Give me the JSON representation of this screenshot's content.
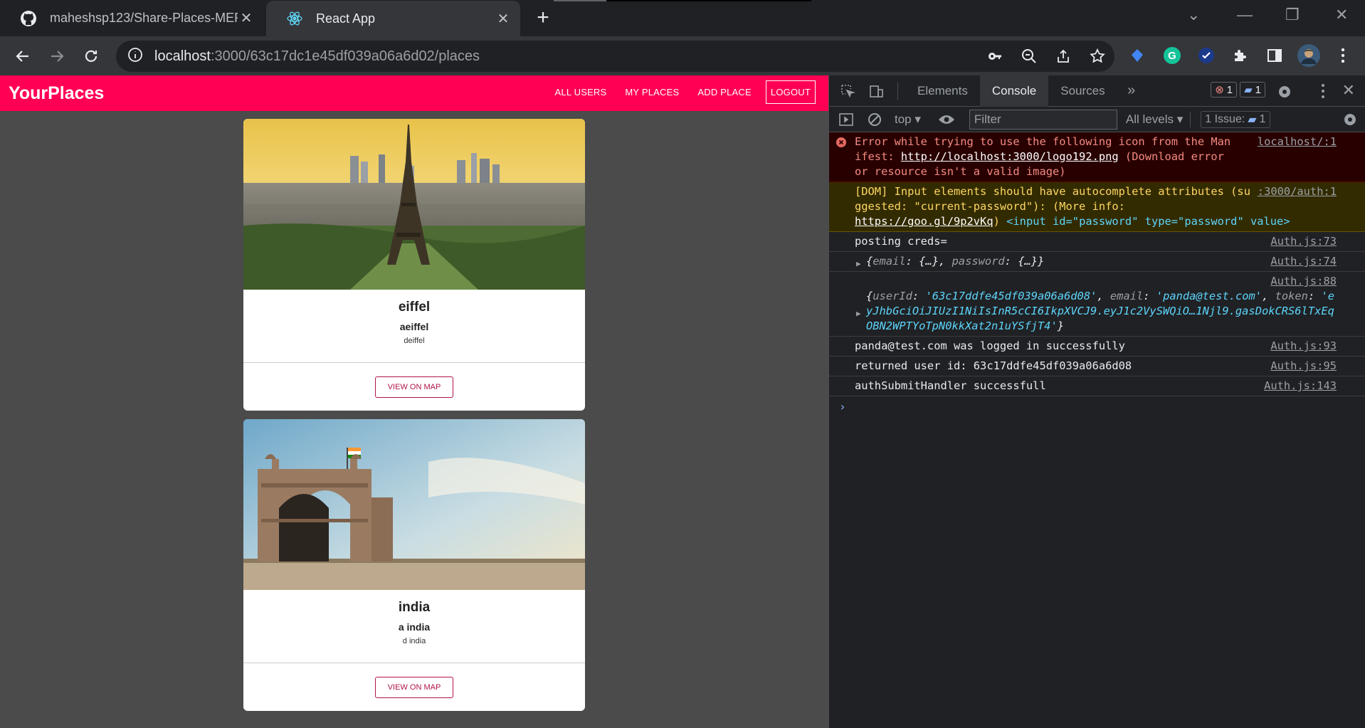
{
  "browser": {
    "tabs": [
      {
        "title": "maheshsp123/Share-Places-MER",
        "active": false,
        "icon": "github-icon"
      },
      {
        "title": "React App",
        "active": true,
        "icon": "react-icon"
      }
    ],
    "url_host": "localhost",
    "url_path": ":3000/63c17dc1e45df039a06a6d02/places"
  },
  "app": {
    "brand": "YourPlaces",
    "accent_color": "#ff0055",
    "nav": [
      "ALL USERS",
      "MY PLACES",
      "ADD PLACE",
      "LOGOUT"
    ],
    "places": [
      {
        "title": "eiffel",
        "address": "aeiffel",
        "description": "deiffel",
        "button": "VIEW ON MAP",
        "image": "eiffel-tower-photo"
      },
      {
        "title": "india",
        "address": "a india",
        "description": "d india",
        "button": "VIEW ON MAP",
        "image": "gateway-of-india-photo"
      }
    ]
  },
  "devtools": {
    "tabs": [
      "Elements",
      "Console",
      "Sources"
    ],
    "active_tab": "Console",
    "error_count": "1",
    "info_count": "1",
    "context": "top",
    "filter_placeholder": "Filter",
    "levels": "All levels",
    "issues_label": "1 Issue:",
    "issues_count": "1",
    "messages": {
      "error": {
        "pre": "Error while trying to use the following icon from the Manifest: ",
        "link": "http://localhost:3000/logo192.png",
        "post": " (Download error or resource isn't a valid image)",
        "src": "localhost/:1"
      },
      "warn": {
        "pre": "[DOM] Input elements should have autocomplete attributes (suggested: \"current-password\"): (More info: ",
        "link": "https://goo.gl/9p2vKq",
        "post": ")   ",
        "code": "<input id=\"password\" type=\"password\" value>",
        "src": ":3000/auth:1"
      },
      "posting": {
        "text": "posting creds=",
        "src": "Auth.js:73"
      },
      "creds_obj": {
        "email_key": "email",
        "email_val": "{…}",
        "password_key": "password",
        "password_val": "{…}",
        "src": "Auth.js:74"
      },
      "response_obj": {
        "userId_key": "userId",
        "userId_val": "'63c17ddfe45df039a06a6d08'",
        "email_key": "email",
        "email_val": "'panda@test.com'",
        "token_key": "token",
        "token_val": "'eyJhbGciOiJIUzI1NiIsInR5cCI6IkpXVCJ9.eyJ1c2VySWQiO…1Njl9.gasDokCRS6lTxEqOBN2WPTYoTpN0kkXat2n1uYSfjT4'",
        "src": "Auth.js:88"
      },
      "logged": {
        "text": "panda@test.com was logged in successfully",
        "src": "Auth.js:93"
      },
      "returned": {
        "text": "returned user id: 63c17ddfe45df039a06a6d08",
        "src": "Auth.js:95"
      },
      "handler": {
        "text": "authSubmitHandler successfull",
        "src": "Auth.js:143"
      }
    }
  }
}
